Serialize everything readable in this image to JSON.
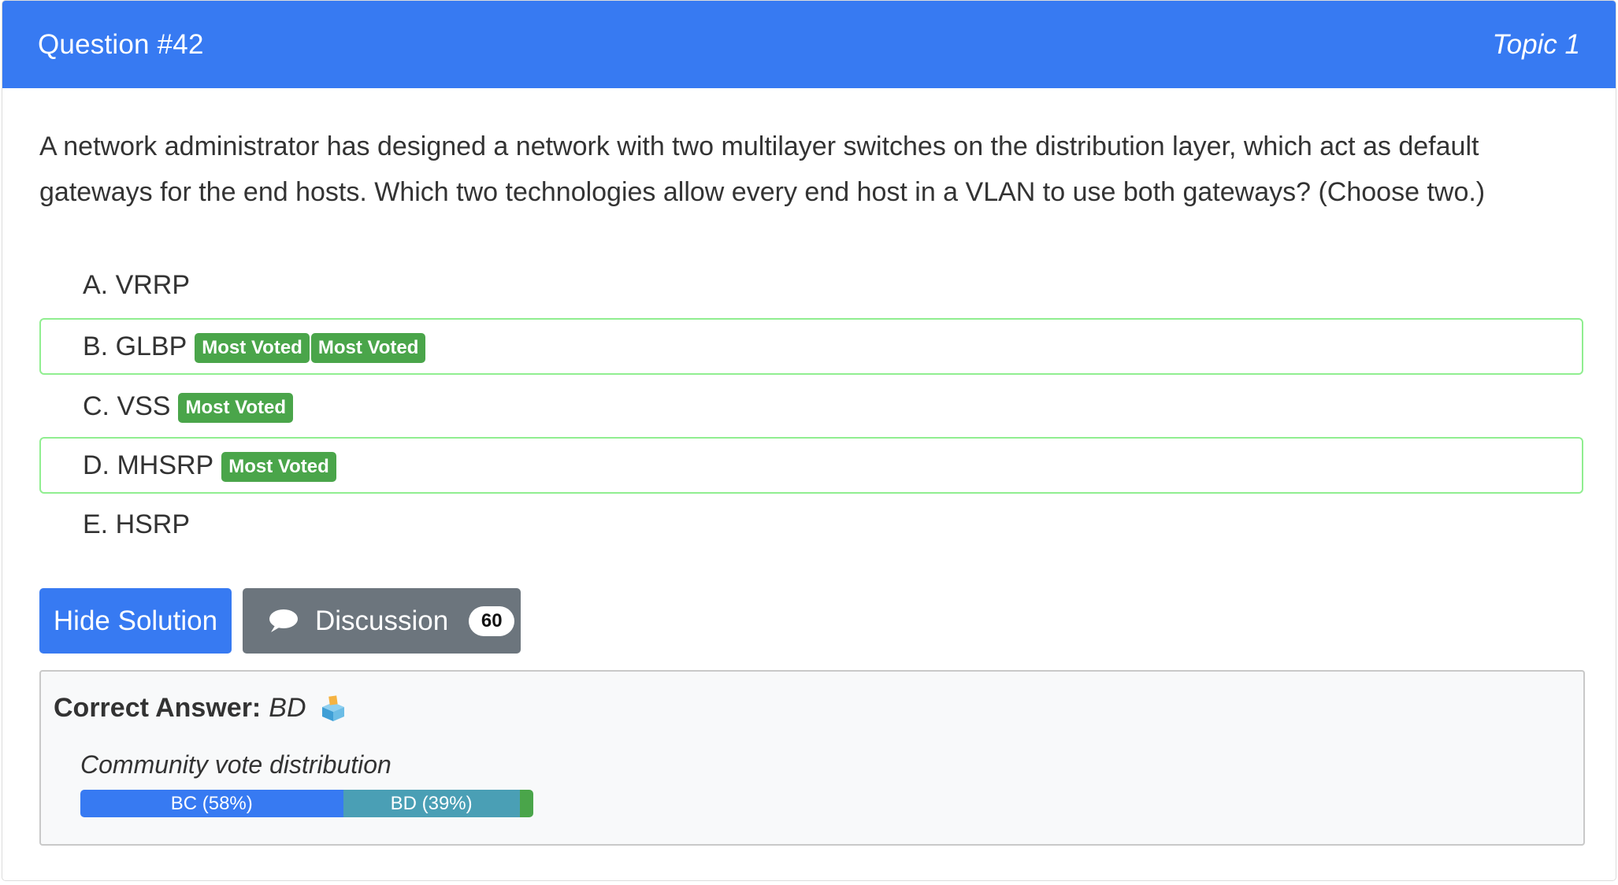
{
  "header": {
    "question_number": "Question #42",
    "topic": "Topic 1"
  },
  "question": {
    "text": "A network administrator has designed a network with two multilayer switches on the distribution layer, which act as default gateways for the end hosts. Which two technologies allow every end host in a VLAN to use both gateways? (Choose two.)"
  },
  "choices": [
    {
      "label": "A. VRRP",
      "badges": [],
      "correct": false
    },
    {
      "label": "B. GLBP",
      "badges": [
        "Most Voted",
        "Most Voted"
      ],
      "correct": true
    },
    {
      "label": "C. VSS",
      "badges": [
        "Most Voted"
      ],
      "correct": false
    },
    {
      "label": "D. MHSRP",
      "badges": [
        "Most Voted"
      ],
      "correct": true
    },
    {
      "label": "E. HSRP",
      "badges": [],
      "correct": false
    }
  ],
  "buttons": {
    "hide_solution": "Hide Solution",
    "discussion": "Discussion",
    "discussion_count": "60"
  },
  "answer": {
    "label": "Correct Answer:",
    "value": "BD",
    "icon": "ballot-box-icon"
  },
  "votes": {
    "title": "Community vote distribution",
    "segments": [
      {
        "label": "BC (58%)",
        "percent": 58,
        "color": "#377af2"
      },
      {
        "label": "BD (39%)",
        "percent": 39,
        "color": "#4a9fb5"
      },
      {
        "label": "",
        "percent": 3,
        "color": "#4aa54a"
      }
    ]
  },
  "colors": {
    "header_bg": "#377af2",
    "badge_green": "#4aa54a",
    "correct_border": "#90ee90",
    "discussion_bg": "#6c757d"
  }
}
